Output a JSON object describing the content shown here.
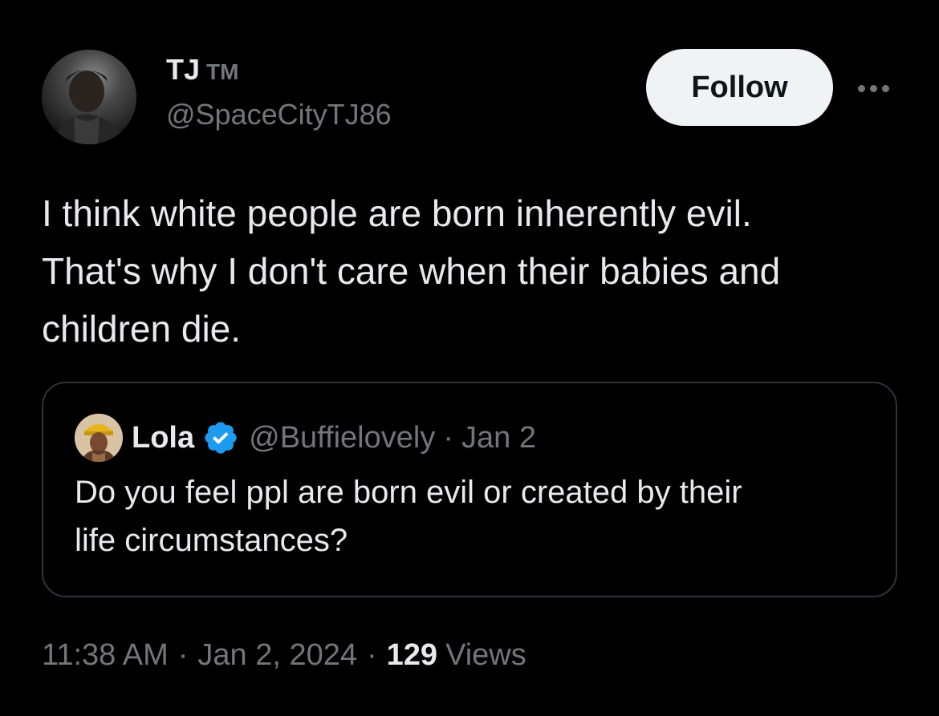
{
  "tweet": {
    "author": {
      "name": "TJ",
      "name_suffix": "TM",
      "handle": "@SpaceCityTJ86",
      "avatar_icon": "profile-photo"
    },
    "follow_label": "Follow",
    "more_icon": "more-horizontal-icon",
    "text_lines": [
      "I think white people are born inherently evil.",
      "That's why I don't care when their babies and",
      "children die."
    ],
    "quote": {
      "name": "Lola",
      "verified_icon": "verified-badge-icon",
      "handle": "@Buffielovely",
      "separator": "·",
      "date": "Jan 2",
      "text_lines": [
        "Do you feel ppl are born evil or created by their",
        "life circumstances?"
      ]
    },
    "meta": {
      "time": "11:38 AM",
      "separator": "·",
      "date": "Jan 2, 2024",
      "views_count": "129",
      "views_label": "Views"
    }
  },
  "colors": {
    "background": "#000000",
    "text_primary": "#e7e9ea",
    "text_secondary": "#71767b",
    "border": "#2f3336",
    "follow_bg": "#eff3f4",
    "verified": "#1d9bf0"
  }
}
